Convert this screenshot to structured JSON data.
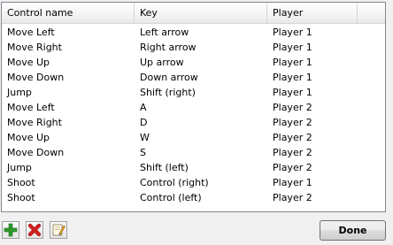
{
  "table": {
    "columns": [
      "Control name",
      "Key",
      "Player"
    ],
    "rows": [
      [
        "Move Left",
        "Left arrow",
        "Player 1"
      ],
      [
        "Move Right",
        "Right arrow",
        "Player 1"
      ],
      [
        "Move Up",
        "Up arrow",
        "Player 1"
      ],
      [
        "Move Down",
        "Down arrow",
        "Player 1"
      ],
      [
        "Jump",
        "Shift (right)",
        "Player 1"
      ],
      [
        "Move Left",
        "A",
        "Player 2"
      ],
      [
        "Move Right",
        "D",
        "Player 2"
      ],
      [
        "Move Up",
        "W",
        "Player 2"
      ],
      [
        "Move Down",
        "S",
        "Player 2"
      ],
      [
        "Jump",
        "Shift (left)",
        "Player 2"
      ],
      [
        "Shoot",
        "Control (right)",
        "Player 1"
      ],
      [
        "Shoot",
        "Control (left)",
        "Player 2"
      ]
    ]
  },
  "toolbar": {
    "add_icon": "plus-icon",
    "delete_icon": "red-x-icon",
    "edit_icon": "edit-pencil-icon",
    "add_color": "#2e9b2e",
    "delete_color": "#d42020"
  },
  "done_label": "Done"
}
